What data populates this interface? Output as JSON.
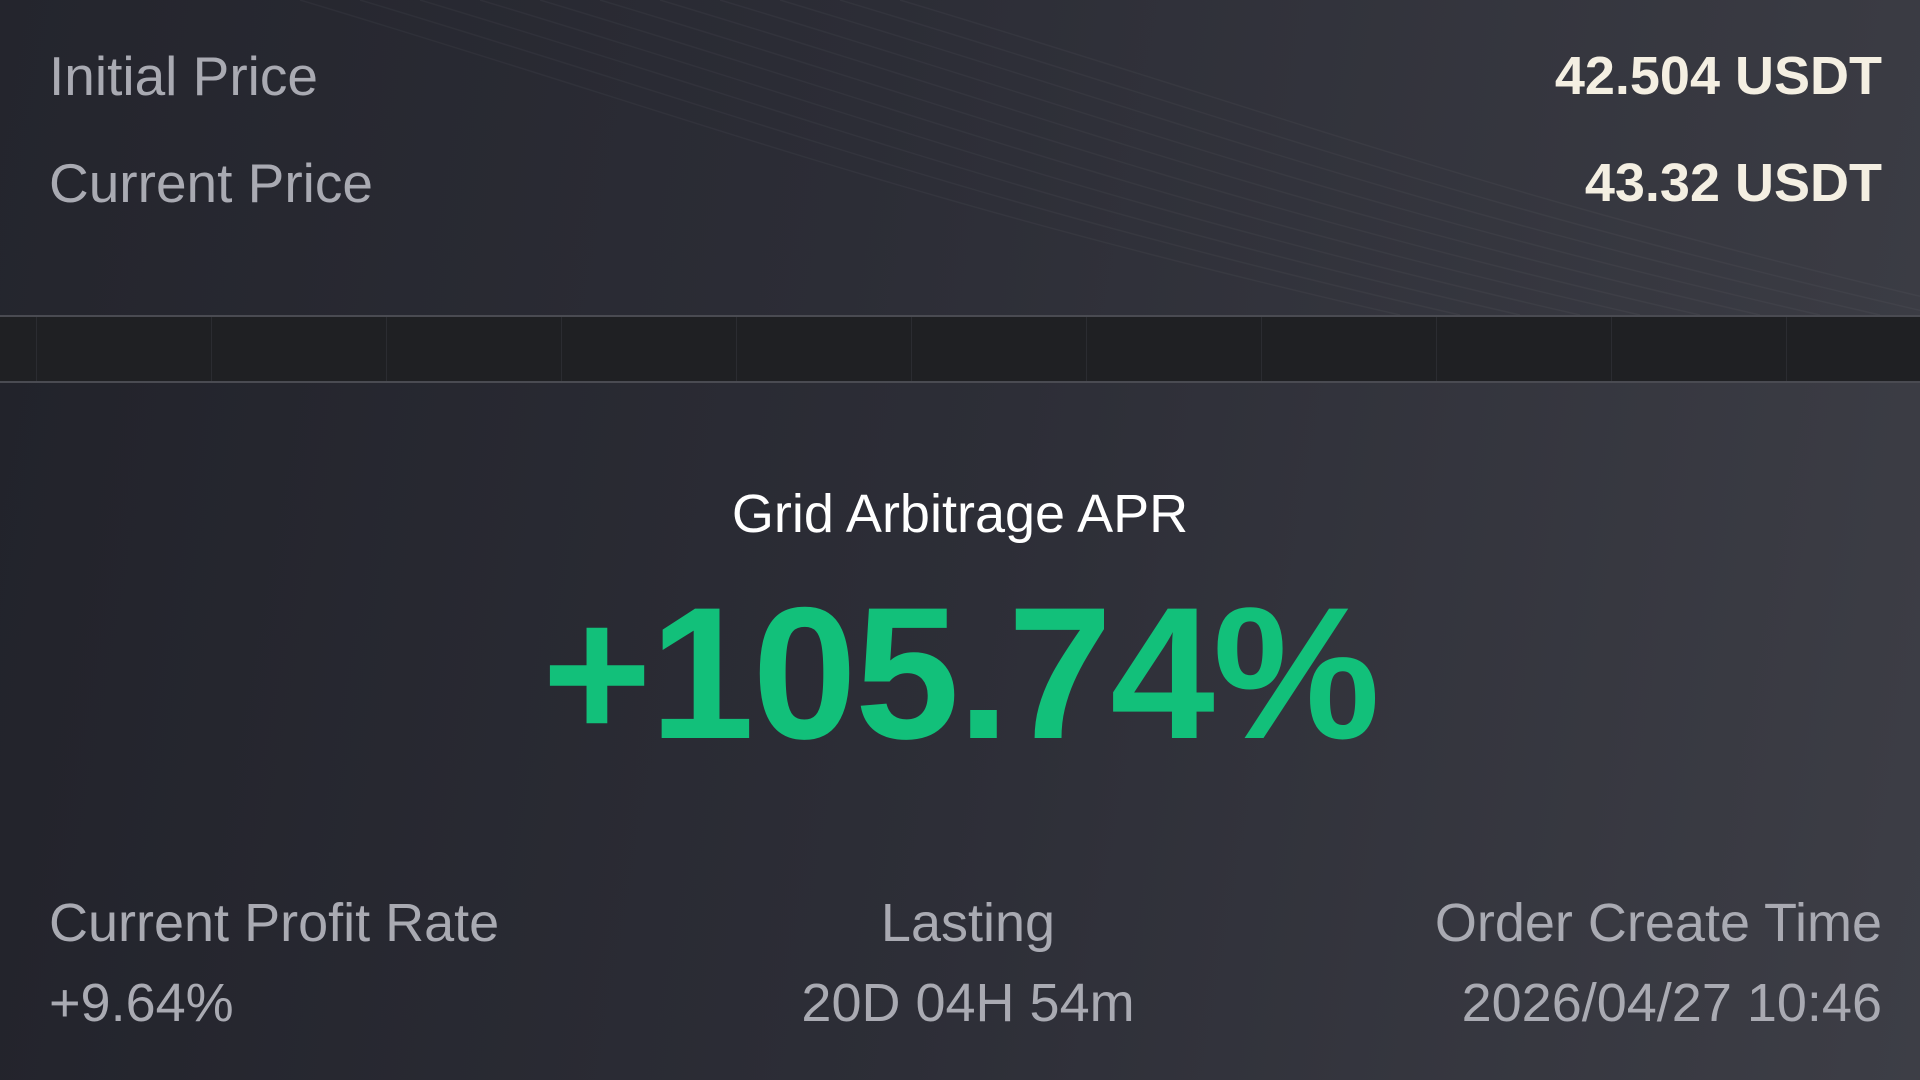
{
  "prices": {
    "initial": {
      "label": "Initial Price",
      "value": "42.504 USDT"
    },
    "current": {
      "label": "Current Price",
      "value": "43.32 USDT"
    }
  },
  "apr": {
    "title": "Grid Arbitrage APR",
    "value": "+105.74%",
    "color": "#12c07a"
  },
  "stats": {
    "profit_rate": {
      "label": "Current Profit Rate",
      "value": "+9.64%"
    },
    "lasting": {
      "label": "Lasting",
      "value": "20D 04H 54m"
    },
    "create_time": {
      "label": "Order Create Time",
      "value": "2026/04/27 10:46"
    }
  }
}
